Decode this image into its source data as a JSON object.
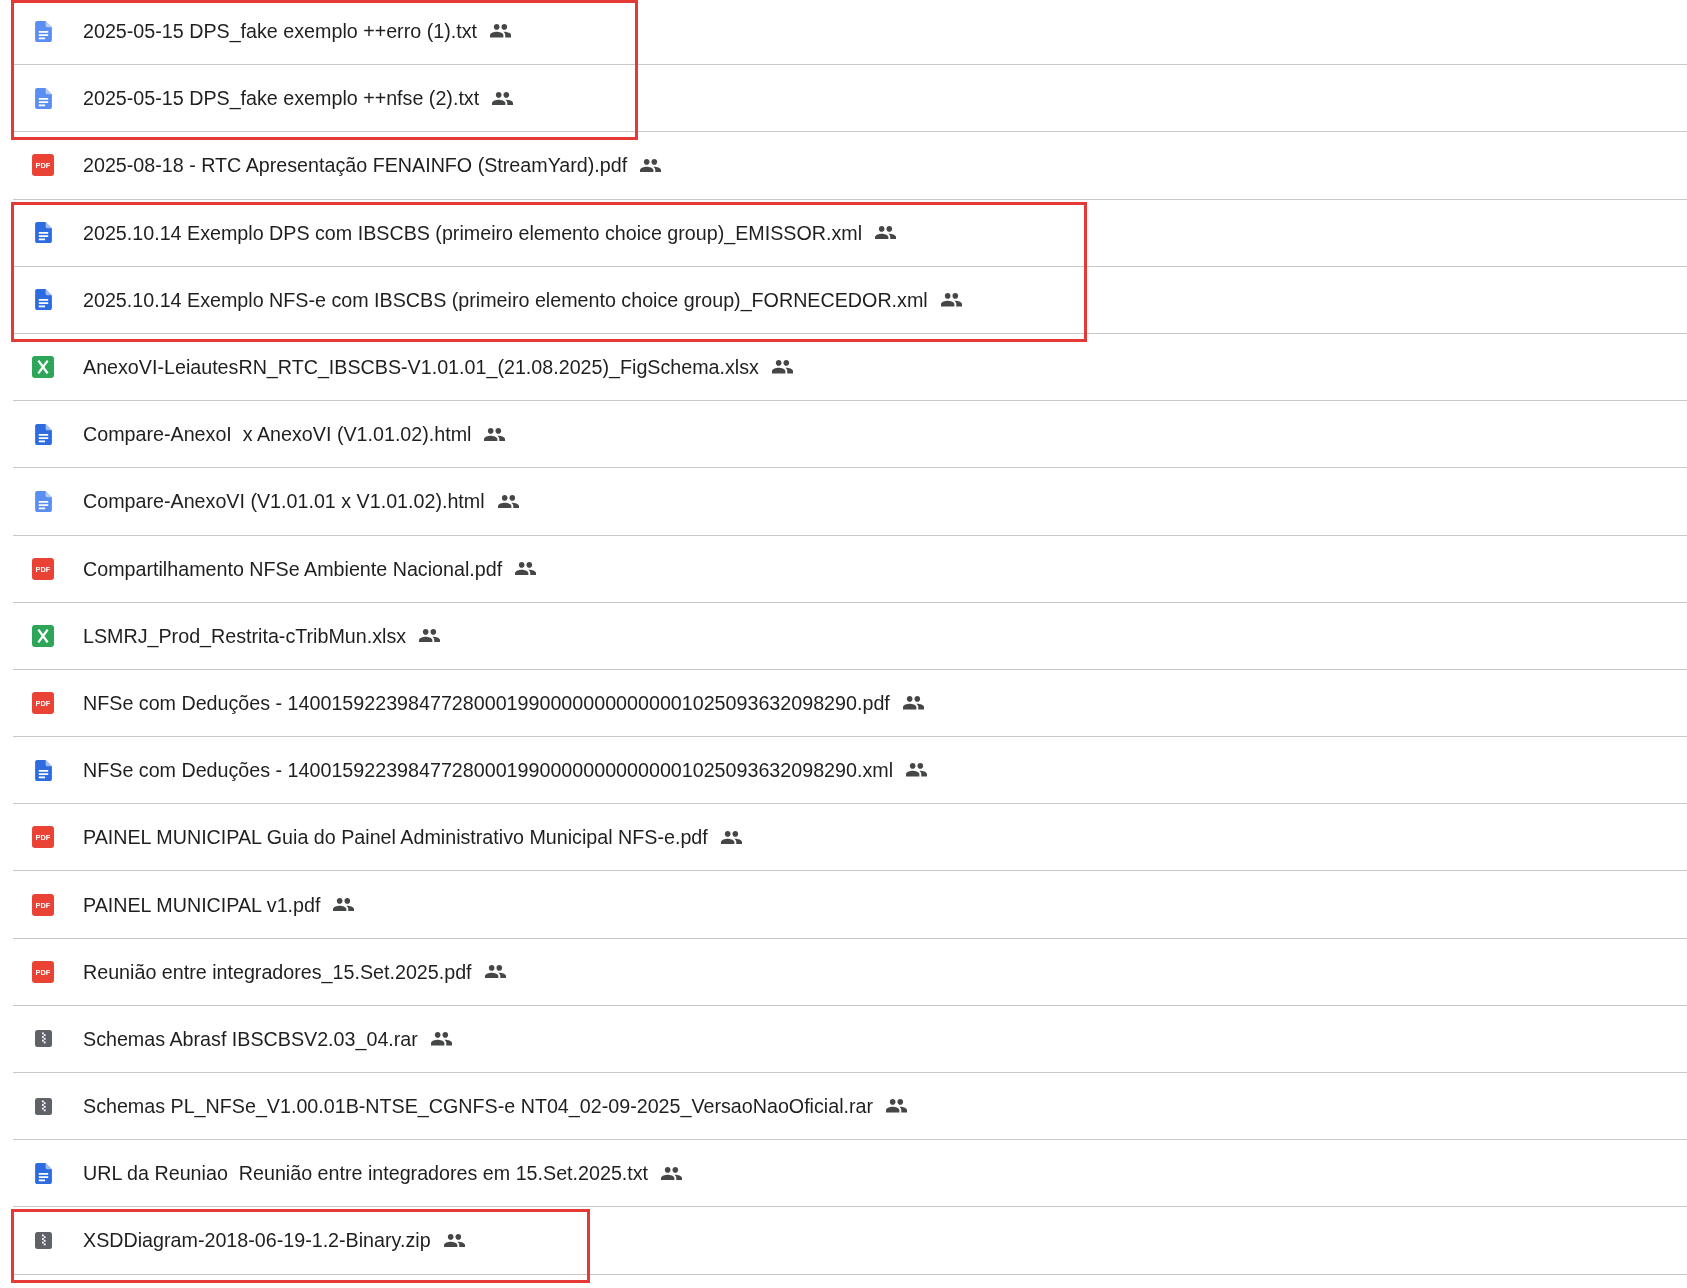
{
  "files": [
    {
      "kind": "doc",
      "color": "#5a8ef2",
      "name": "2025-05-15 DPS_fake exemplo ++erro (1).txt",
      "shared": true,
      "highlighted": true
    },
    {
      "kind": "doc",
      "color": "#5a8ef2",
      "name": "2025-05-15 DPS_fake exemplo ++nfse (2).txt",
      "shared": true,
      "highlighted": true
    },
    {
      "kind": "pdf",
      "icon_text": "PDF",
      "name": "2025-08-18 - RTC Apresentação FENAINFO (StreamYard).pdf",
      "shared": true,
      "highlighted": false
    },
    {
      "kind": "doc",
      "color": "#2d6be0",
      "name": "2025.10.14 Exemplo DPS com IBSCBS (primeiro elemento choice group)_EMISSOR.xml",
      "shared": true,
      "highlighted": true
    },
    {
      "kind": "doc",
      "color": "#2d6be0",
      "name": "2025.10.14 Exemplo NFS-e com IBSCBS (primeiro elemento choice group)_FORNECEDOR.xml",
      "shared": true,
      "highlighted": true
    },
    {
      "kind": "sheet",
      "name": "AnexoVI-LeiautesRN_RTC_IBSCBS-V1.01.01_(21.08.2025)_FigSchema.xlsx",
      "shared": true,
      "highlighted": false
    },
    {
      "kind": "doc",
      "color": "#2d6be0",
      "name": "Compare-AnexoI  x AnexoVI (V1.01.02).html",
      "shared": true,
      "highlighted": false
    },
    {
      "kind": "doc",
      "color": "#5a8ef2",
      "name": "Compare-AnexoVI (V1.01.01 x V1.01.02).html",
      "shared": true,
      "highlighted": false
    },
    {
      "kind": "pdf",
      "icon_text": "PDF",
      "name": "Compartilhamento NFSe Ambiente Nacional.pdf",
      "shared": true,
      "highlighted": false
    },
    {
      "kind": "sheet",
      "name": "LSMRJ_Prod_Restrita-cTribMun.xlsx",
      "shared": true,
      "highlighted": false
    },
    {
      "kind": "pdf",
      "icon_text": "PDF",
      "name": "NFSe com Deduções - 1400159223984772800019900000000000001025093632098290.pdf",
      "shared": true,
      "highlighted": false
    },
    {
      "kind": "doc",
      "color": "#2d6be0",
      "name": "NFSe com Deduções - 1400159223984772800019900000000000001025093632098290.xml",
      "shared": true,
      "highlighted": false
    },
    {
      "kind": "pdf",
      "icon_text": "PDF",
      "name": "PAINEL MUNICIPAL Guia do Painel Administrativo Municipal NFS-e.pdf",
      "shared": true,
      "highlighted": false
    },
    {
      "kind": "pdf",
      "icon_text": "PDF",
      "name": "PAINEL MUNICIPAL v1.pdf",
      "shared": true,
      "highlighted": false
    },
    {
      "kind": "pdf",
      "icon_text": "PDF",
      "name": "Reunião entre integradores_15.Set.2025.pdf",
      "shared": true,
      "highlighted": false
    },
    {
      "kind": "archive",
      "name": "Schemas Abrasf IBSCBSV2.03_04.rar",
      "shared": true,
      "highlighted": false
    },
    {
      "kind": "archive",
      "name": "Schemas PL_NFSe_V1.00.01B-NTSE_CGNFS-e NT04_02-09-2025_VersaoNaoOficial.rar",
      "shared": true,
      "highlighted": false
    },
    {
      "kind": "doc",
      "color": "#2d6be0",
      "name": "URL da Reuniao  Reunião entre integradores em 15.Set.2025.txt",
      "shared": true,
      "highlighted": false
    },
    {
      "kind": "archive",
      "name": "XSDDiagram-2018-06-19-1.2-Binary.zip",
      "shared": true,
      "highlighted": true
    }
  ]
}
